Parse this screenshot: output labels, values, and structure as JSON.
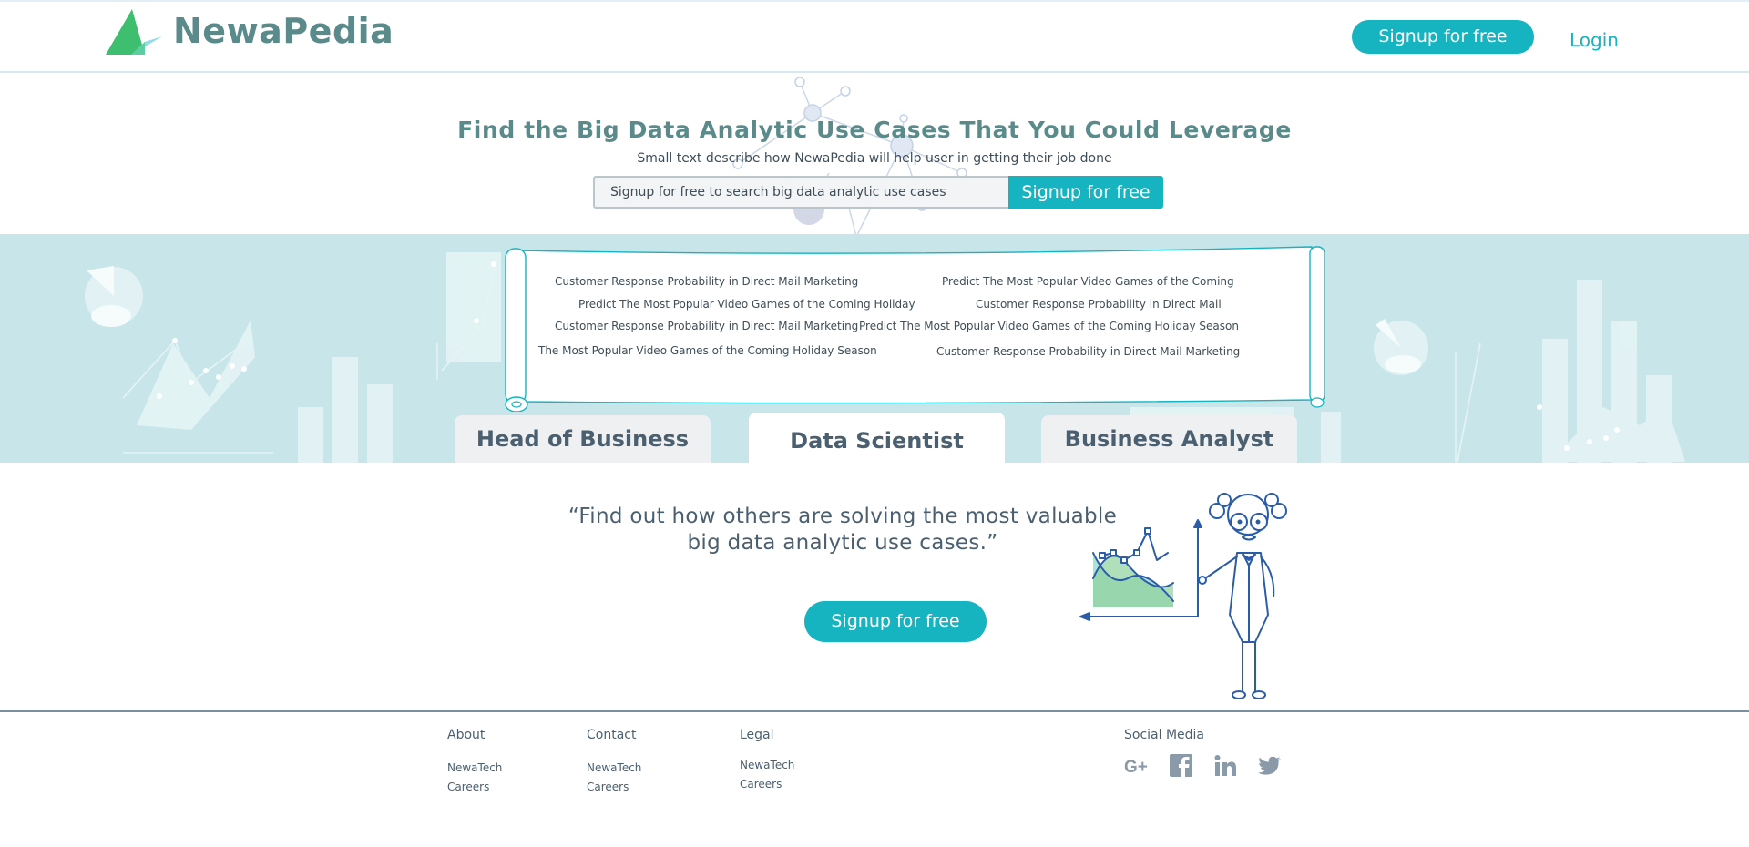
{
  "header": {
    "brand": "NewaPedia",
    "signup_label": "Signup for free",
    "login_label": "Login"
  },
  "hero": {
    "title": "Find the Big Data Analytic Use Cases That You Could Leverage",
    "subtitle": "Small text describe how NewaPedia will help user in getting their job done",
    "search_placeholder": "Signup for free to search big data analytic use cases",
    "search_button": "Signup for free"
  },
  "scroll": {
    "items": [
      "Customer Response Probability in Direct Mail Marketing",
      "Predict The Most Popular Video Games of the Coming",
      "Predict The Most Popular Video Games of the Coming Holiday",
      "Customer Response Probability in Direct Mail",
      "Customer Response Probability in Direct Mail Marketing",
      "Predict The Most Popular Video Games of the Coming Holiday Season",
      "The Most Popular Video Games of the Coming Holiday Season",
      "Customer Response Probability in Direct Mail Marketing"
    ]
  },
  "tabs": [
    {
      "label": "Head of Business",
      "active": false
    },
    {
      "label": "Data Scientist",
      "active": true
    },
    {
      "label": "Business Analyst",
      "active": false
    }
  ],
  "main": {
    "quote_line1": "“Find out how others are solving the most valuable",
    "quote_line2": "big data analytic use cases.”",
    "signup_label": "Signup for free"
  },
  "footer": {
    "columns": [
      {
        "title": "About",
        "links": [
          "NewaTech",
          "Careers"
        ]
      },
      {
        "title": "Contact",
        "links": [
          "NewaTech",
          "Careers"
        ]
      },
      {
        "title": "Legal",
        "links": [
          "NewaTech",
          "Careers"
        ]
      }
    ],
    "social_title": "Social Media",
    "social_icons": [
      "google-plus-icon",
      "facebook-icon",
      "linkedin-icon",
      "twitter-icon"
    ]
  },
  "colors": {
    "accent": "#16b3c0",
    "brand_text": "#5a8a89",
    "band": "#c8e6ea",
    "logo_green": "#3dbf6f",
    "logo_teal": "#7fd6e0",
    "illustration_blue": "#2b5ca8"
  }
}
